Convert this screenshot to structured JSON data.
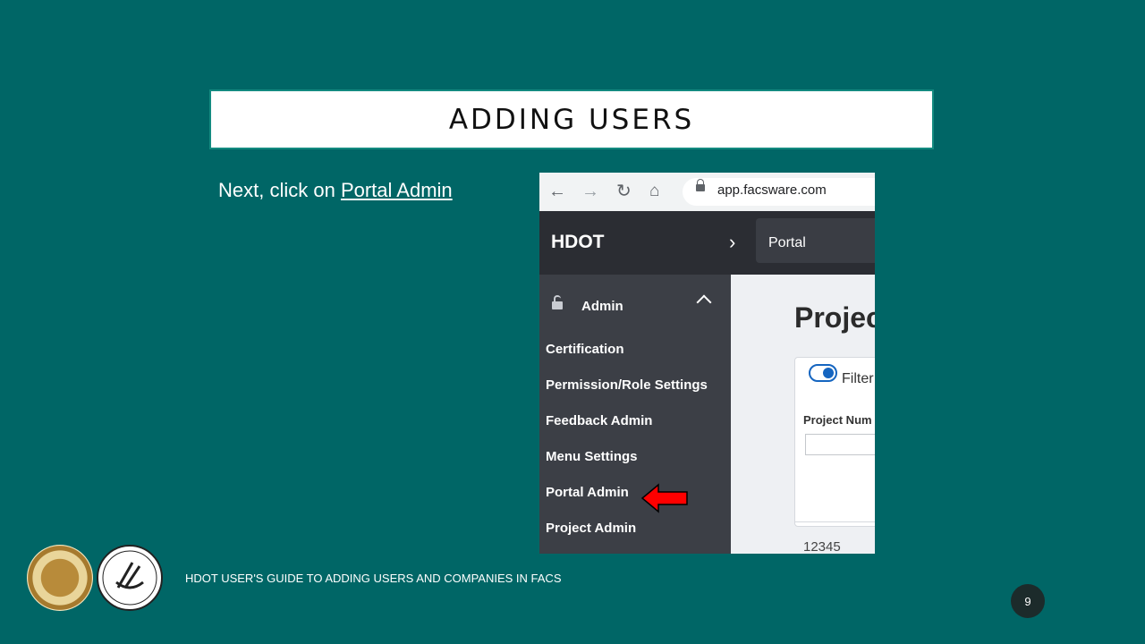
{
  "slide": {
    "title": "ADDING USERS",
    "instruction_prefix": "Next, click on ",
    "instruction_link": "Portal Admin",
    "footer": "HDOT USER'S GUIDE TO  ADDING USERS AND COMPANIES IN FACS",
    "page_number": "9"
  },
  "screenshot": {
    "browser": {
      "url": "app.facsware.com",
      "icons": [
        "back-arrow-icon",
        "forward-arrow-icon",
        "reload-icon",
        "home-icon",
        "lock-icon"
      ]
    },
    "appbar": {
      "brand": "HDOT",
      "breadcrumb": "Portal"
    },
    "sidebar": {
      "section": "Admin",
      "items": [
        {
          "label": "Certification"
        },
        {
          "label": "Permission/Role Settings"
        },
        {
          "label": "Feedback Admin"
        },
        {
          "label": "Menu Settings"
        },
        {
          "label": "Portal Admin"
        },
        {
          "label": "Project Admin"
        }
      ]
    },
    "content": {
      "page_title": "Projec",
      "filter_label": "Filter",
      "column_header": "Project Num",
      "row_value": "12345"
    },
    "colors": {
      "slide_bg": "#006666",
      "sidebar_bg": "#3c3f46",
      "appbar_bg": "#2b2d33",
      "arrow": "#ff0000"
    }
  }
}
